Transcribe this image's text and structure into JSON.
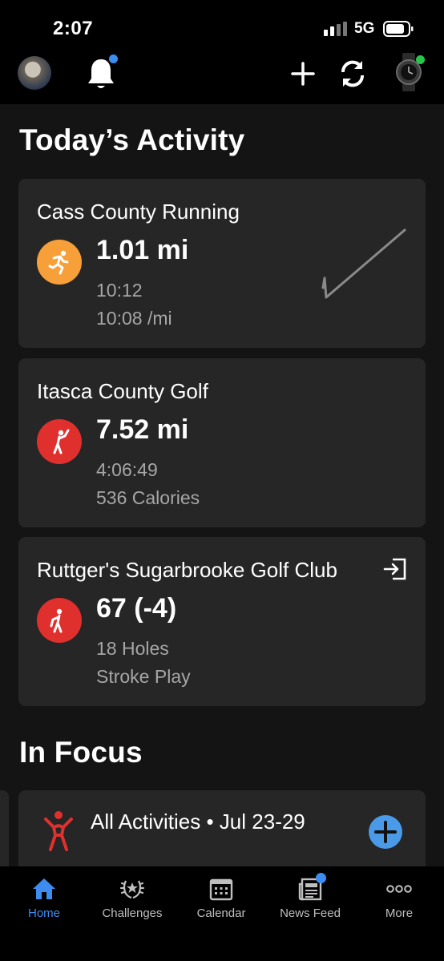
{
  "status_bar": {
    "time": "2:07",
    "network": "5G"
  },
  "header": {
    "avatar_icon": "avatar",
    "bell_icon": "bell-icon",
    "add_icon": "plus-icon",
    "sync_icon": "sync-icon",
    "device_icon": "watch-icon"
  },
  "today": {
    "title": "Today’s Activity",
    "activities": [
      {
        "name": "Cass County Running",
        "primary": "1.01 mi",
        "line1": "10:12",
        "line2": "10:08 /mi",
        "icon": "running-icon",
        "color": "#f7a03a"
      },
      {
        "name": "Itasca County Golf",
        "primary": "7.52 mi",
        "line1": "4:06:49",
        "line2": "536 Calories",
        "icon": "golf-icon",
        "color": "#e0302e"
      },
      {
        "name": "Ruttger's Sugarbrooke Golf Club",
        "primary": "67 (-4)",
        "line1": "18 Holes",
        "line2": "Stroke Play",
        "icon": "golf-icon",
        "color": "#e0302e"
      }
    ]
  },
  "focus": {
    "title": "In Focus",
    "card_label": "All Activities • Jul 23-29"
  },
  "tabs": [
    {
      "label": "Home",
      "icon": "home-icon",
      "active": true
    },
    {
      "label": "Challenges",
      "icon": "laurel-icon"
    },
    {
      "label": "Calendar",
      "icon": "calendar-icon"
    },
    {
      "label": "News Feed",
      "icon": "newspaper-icon"
    },
    {
      "label": "More",
      "icon": "more-icon"
    }
  ],
  "colors": {
    "accent": "#3d8df0",
    "running": "#f7a03a",
    "golf": "#e0302e",
    "online": "#29c44b"
  }
}
